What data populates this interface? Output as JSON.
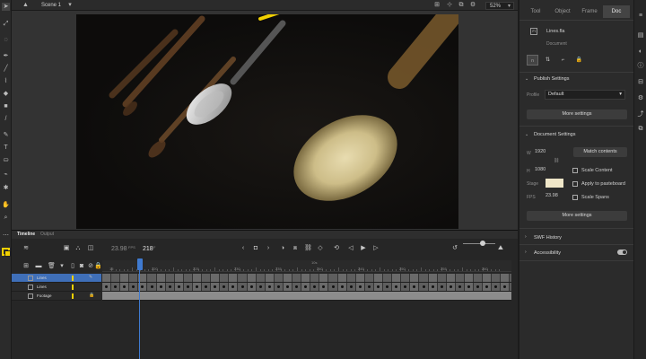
{
  "topbar": {
    "scene_label": "Scene 1",
    "zoom_value": "52%",
    "icons": [
      "scene-icon",
      "edit-symbols-icon",
      "center-stage-icon",
      "clip-icon",
      "settings-icon"
    ]
  },
  "timeline": {
    "tabs": {
      "timeline": "Timeline",
      "output": "Output"
    },
    "fps": "23.98",
    "fps_unit": "FPS",
    "current_frame": "218",
    "frame_unit": "F",
    "ruler_ticks": [
      "220",
      "225",
      "230",
      "235",
      "240",
      "245",
      "250",
      "255",
      "260"
    ],
    "ruler_first": "15",
    "ruler_seconds": "10s",
    "layers": [
      {
        "name": "Lines",
        "color": "#f0d000",
        "selected": true
      },
      {
        "name": "Lines",
        "color": "#f0d000",
        "selected": false
      },
      {
        "name": "Footage",
        "color": "#f0d000",
        "selected": false
      }
    ]
  },
  "properties": {
    "tabs": [
      "Tool",
      "Object",
      "Frame",
      "Doc"
    ],
    "active_tab": "Doc",
    "file_name": "Lines.fla",
    "doc_label": "Document",
    "publish_section": "Publish Settings",
    "profile_label": "Profile",
    "profile_value": "Default",
    "more_settings_1": "More settings",
    "document_section": "Document Settings",
    "width_label": "W",
    "width_value": "1920",
    "height_label": "H",
    "height_value": "1080",
    "match_contents": "Match contents",
    "scale_content": "Scale Content",
    "stage_label": "Stage",
    "stage_color": "#efe6c8",
    "apply_pasteboard": "Apply to pasteboard",
    "fps_label": "FPS",
    "fps_value": "23.98",
    "scale_spans": "Scale Spans",
    "more_settings_2": "More settings",
    "swf_history": "SWF History",
    "accessibility": "Accessibility"
  }
}
